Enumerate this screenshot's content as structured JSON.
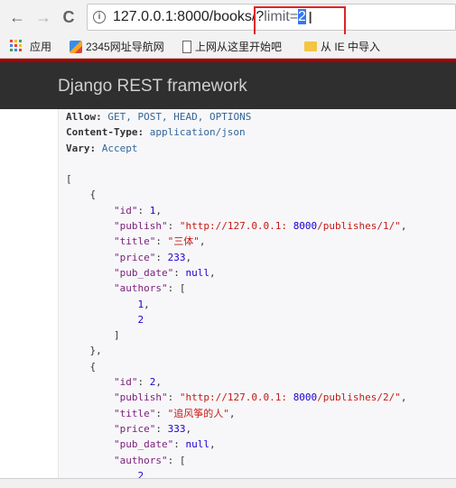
{
  "browser": {
    "back_glyph": "←",
    "forward_glyph": "→",
    "reload_glyph": "C",
    "url_base": "127.0.0.1:8000/books/?",
    "url_query_prefix": "limit=",
    "url_query_selected": "2",
    "info_glyph": "i"
  },
  "bookmarks": [
    {
      "label": "应用",
      "icon": "apps-icon"
    },
    {
      "label": "2345网址导航网",
      "icon": "site-logo-icon"
    },
    {
      "label": "上网从这里开始吧",
      "icon": "page-icon"
    },
    {
      "label": "从 IE 中导入",
      "icon": "folder-icon"
    }
  ],
  "drf": {
    "brand": "Django REST framework"
  },
  "response": {
    "headers": [
      {
        "key": "Allow:",
        "value": "GET, POST, HEAD, OPTIONS"
      },
      {
        "key": "Content-Type:",
        "value": "application/json"
      },
      {
        "key": "Vary:",
        "value": "Accept"
      }
    ],
    "lines": [
      "[",
      "    {",
      "        \"id\": 1,",
      "        \"publish\": \"http://127.0.0.1:8000/publishes/1/\",",
      "        \"title\": \"三体\",",
      "        \"price\": 233,",
      "        \"pub_date\": null,",
      "        \"authors\": [",
      "            1,",
      "            2",
      "        ]",
      "    },",
      "    {",
      "        \"id\": 2,",
      "        \"publish\": \"http://127.0.0.1:8000/publishes/2/\",",
      "        \"title\": \"追风筝的人\",",
      "        \"price\": 333,",
      "        \"pub_date\": null,",
      "        \"authors\": [",
      "            2"
    ]
  },
  "colors": {
    "drf_red": "#a30000",
    "drf_nav": "#2f2f2f",
    "selection": "#3478f6",
    "annotation_red": "#e02424"
  }
}
